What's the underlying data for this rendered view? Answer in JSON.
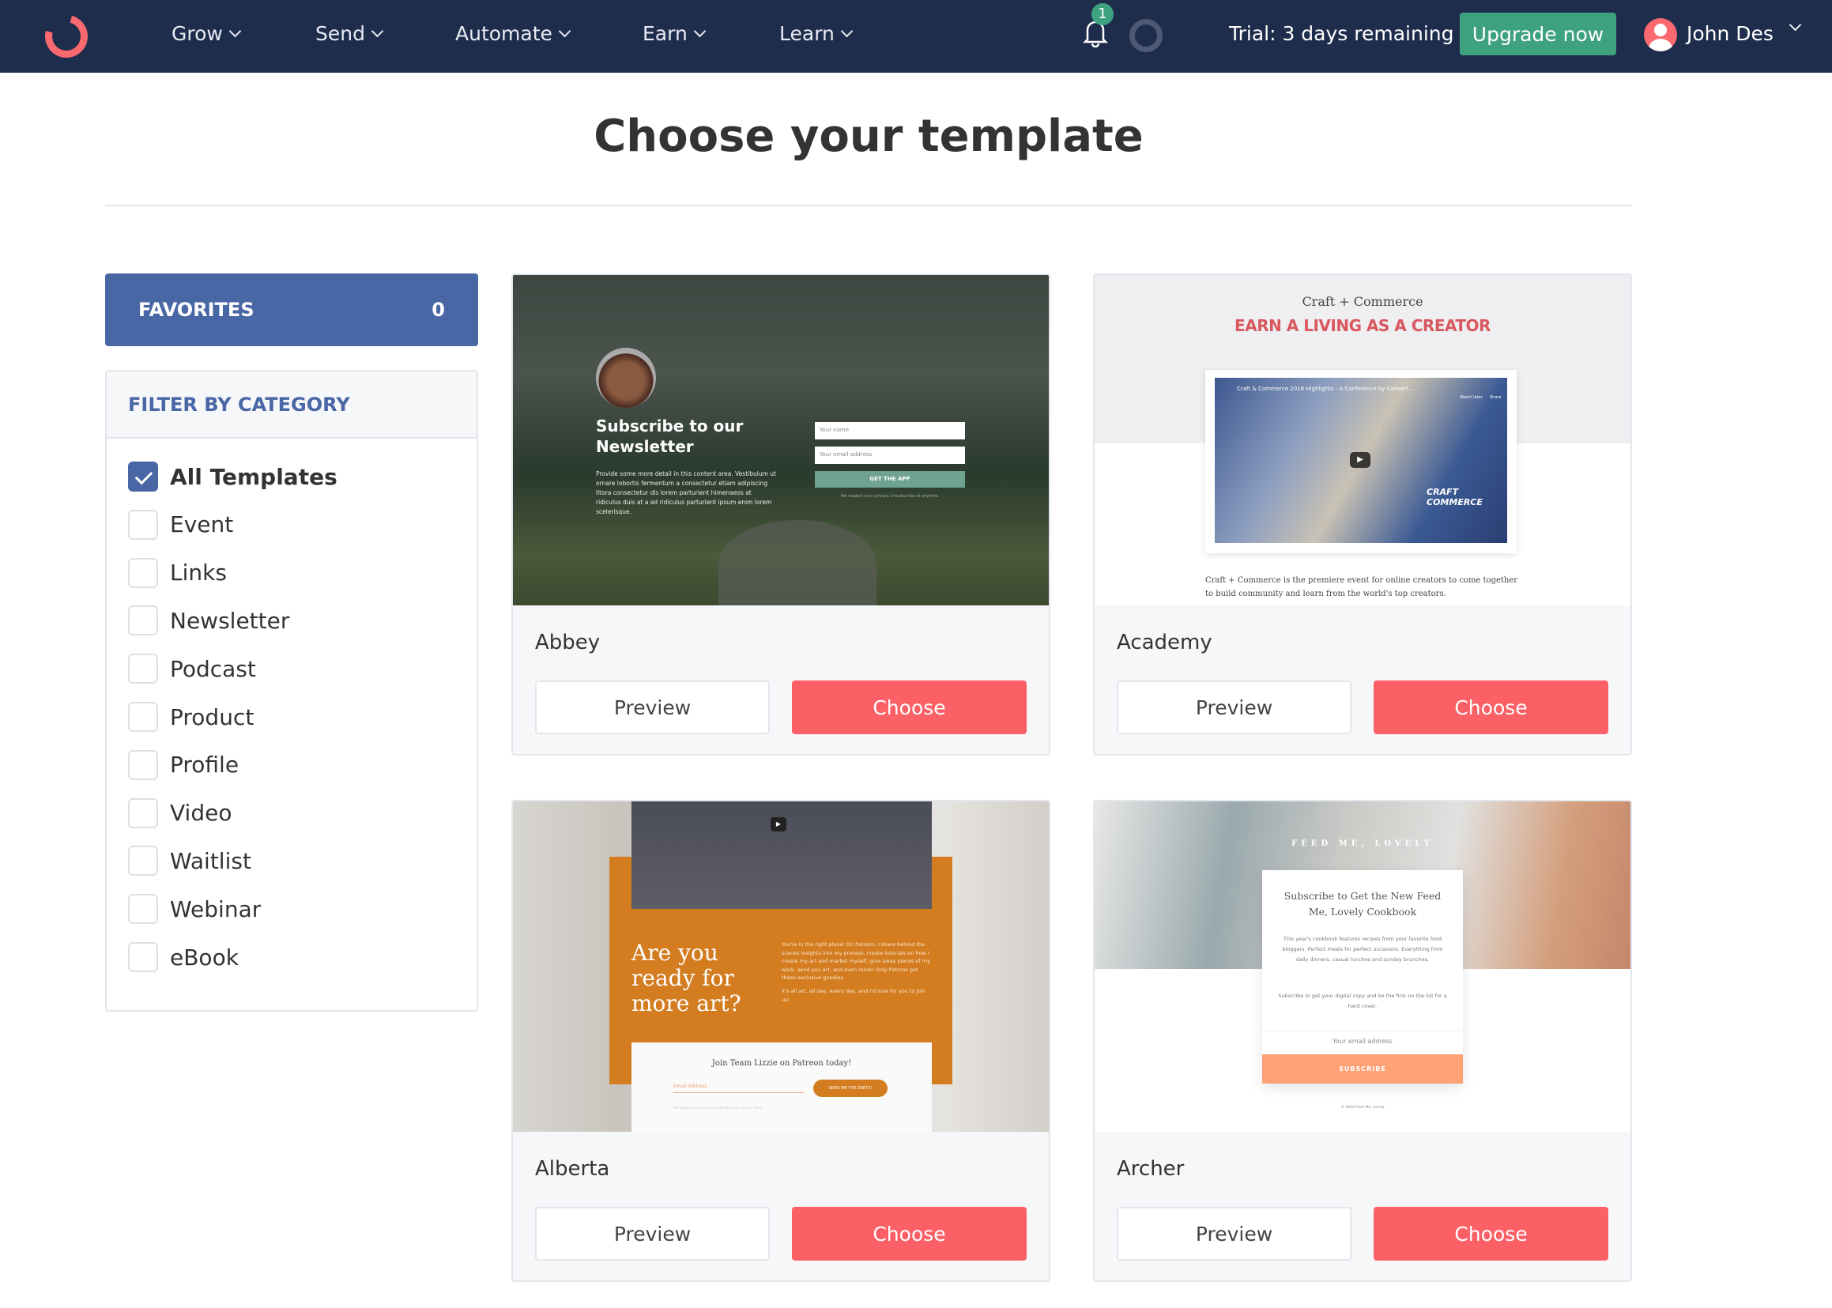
{
  "nav": {
    "items": [
      {
        "label": "Grow"
      },
      {
        "label": "Send"
      },
      {
        "label": "Automate"
      },
      {
        "label": "Earn"
      },
      {
        "label": "Learn"
      }
    ],
    "notification_count": "1",
    "trial": "Trial: 3 days remaining",
    "upgrade": "Upgrade now",
    "user": "John Des",
    "icons": [
      "logo",
      "bell-icon",
      "status-ring-icon",
      "avatar",
      "chevron-down-icon"
    ]
  },
  "page": {
    "title": "Choose your template"
  },
  "favorites": {
    "label": "FAVORITES",
    "count": "0"
  },
  "filter": {
    "title": "FILTER BY CATEGORY",
    "categories": [
      {
        "label": "All Templates",
        "checked": true
      },
      {
        "label": "Event",
        "checked": false
      },
      {
        "label": "Links",
        "checked": false
      },
      {
        "label": "Newsletter",
        "checked": false
      },
      {
        "label": "Podcast",
        "checked": false
      },
      {
        "label": "Product",
        "checked": false
      },
      {
        "label": "Profile",
        "checked": false
      },
      {
        "label": "Video",
        "checked": false
      },
      {
        "label": "Waitlist",
        "checked": false
      },
      {
        "label": "Webinar",
        "checked": false
      },
      {
        "label": "eBook",
        "checked": false
      }
    ]
  },
  "templates": [
    {
      "name": "Abbey",
      "preview_label": "Preview",
      "choose_label": "Choose",
      "content": {
        "heading": "Subscribe to our Newsletter",
        "body": "Provide some more detail in this content area. Vestibulum ut ornare lobortis fermentum a consectetur etiam adipiscing litora consectetur dis lorem parturient himenaeos at ridiculus duis at a ad ridiculus parturient ipsum enim lorem scelerisque.",
        "name_placeholder": "Your name",
        "email_placeholder": "Your email address",
        "button": "GET THE APP",
        "note": "We respect your privacy. Unsubscribe at anytime."
      }
    },
    {
      "name": "Academy",
      "preview_label": "Preview",
      "choose_label": "Choose",
      "content": {
        "kicker": "Craft + Commerce",
        "heading": "EARN A LIVING AS A CREATOR",
        "video_title": "Craft & Commerce 2018 Highlights - A Conference by Convert...",
        "watch_later": "Watch later",
        "share": "Share",
        "logo_text": "CRAFT COMMERCE",
        "body": "Craft + Commerce is the premiere event for online creators to come together to build community and learn from the world's top creators."
      }
    },
    {
      "name": "Alberta",
      "preview_label": "Preview",
      "choose_label": "Choose",
      "content": {
        "heading": "Are you ready for more art?",
        "body1": "You're in the right place! On Patreon, I share behind the scenes insights into my process, create tutorials on how I create my art and market myself, give away pieces of my work, send you art, and even more! Only Patrons get these exclusive goodies.",
        "body2": "It's all art, all day, every day, and I'd love for you to join us!",
        "form_title": "Join Team Lizzie on Patreon today!",
        "email_placeholder": "Email Address",
        "button": "SEND ME THE DEETS!",
        "note": "We respect your privacy. Unsubscribe at any time."
      }
    },
    {
      "name": "Archer",
      "preview_label": "Preview",
      "choose_label": "Choose",
      "content": {
        "brand": "FEED ME, LOVELY",
        "heading": "Subscribe to Get the New Feed Me, Lovely Cookbook",
        "body1": "This year's cookbook features recipes from your favorite food bloggers. Perfect meals for perfect occasions. Everything from daily dinners, casual lunches and sunday brunches.",
        "body2": "Subscribe to get your digital copy and be the first on the list for a hard cover.",
        "email_placeholder": "Your email address",
        "button": "SUBSCRIBE",
        "footer": "© 2019 Feed Me, Lovely"
      }
    }
  ],
  "colors": {
    "nav": "#1f2d4d",
    "accent": "#4966a5",
    "choose": "#fb6066",
    "upgrade": "#3ea27f"
  }
}
